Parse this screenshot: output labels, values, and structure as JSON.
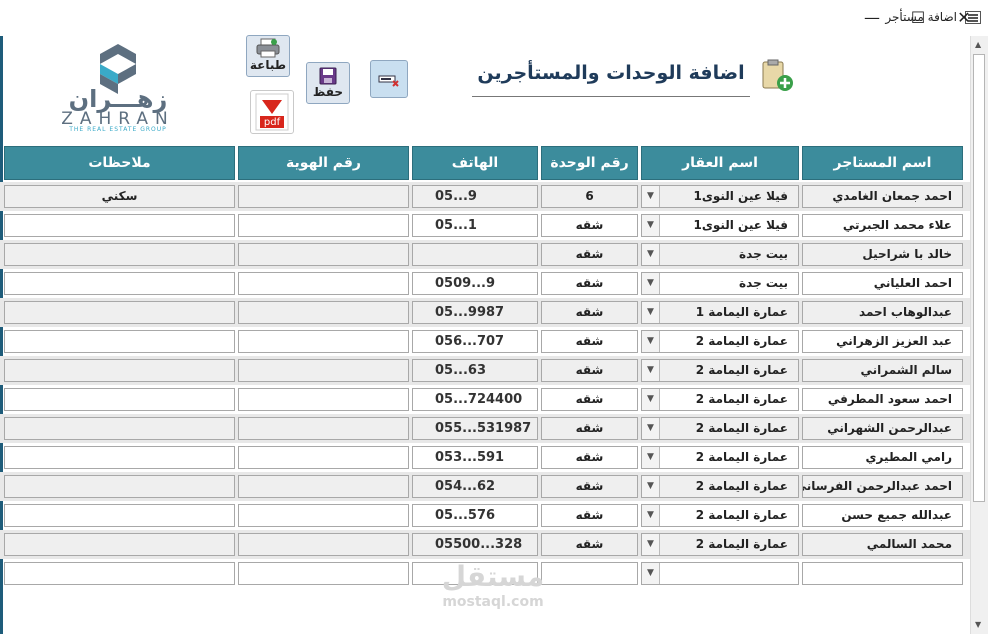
{
  "window": {
    "title": "اضافة مستأجر",
    "minimize": "—",
    "maximize": "☐",
    "close": "✕"
  },
  "logo": {
    "arabic": "زهـــران",
    "latin": "ZAHRAN",
    "tagline": "THE REAL ESTATE GROUP",
    "colors": {
      "primary": "#5d6f80",
      "accent": "#3aaac8"
    }
  },
  "toolbar": {
    "print_label": "طباعة",
    "save_label": "حفظ",
    "pdf_label": "pdf",
    "delete_icon": "delete-record-icon"
  },
  "form_title": "اضافة الوحدات والمستأجرين",
  "columns": {
    "tenant_name": "اسم المستاجر",
    "property_name": "اسم العقار",
    "unit_number": "رقم الوحدة",
    "phone": "الهاتف",
    "id_number": "رقم الهوية",
    "notes": "ملاحظات"
  },
  "rows": [
    {
      "tenant": "احمد جمعان الغامدي",
      "property": "فيلا عين النوى1",
      "unit": "6",
      "phone": "05...9",
      "id": "",
      "notes": "سكني"
    },
    {
      "tenant": "علاء محمد الجبرتي",
      "property": "فيلا عين النوى1",
      "unit": "شقه",
      "phone": "05...1",
      "id": "",
      "notes": ""
    },
    {
      "tenant": "خالد با شراحيل",
      "property": "بيت جدة",
      "unit": "شقه",
      "phone": "",
      "id": "",
      "notes": ""
    },
    {
      "tenant": "احمد العلياني",
      "property": "بيت جدة",
      "unit": "شقه",
      "phone": "0509...9",
      "id": "",
      "notes": ""
    },
    {
      "tenant": "عبدالوهاب احمد",
      "property": "عمارة اليمامة 1",
      "unit": "شقه",
      "phone": "05...9987",
      "id": "",
      "notes": ""
    },
    {
      "tenant": "عبد العزيز الزهراني",
      "property": "عمارة اليمامة 2",
      "unit": "شقه",
      "phone": "056...707",
      "id": "",
      "notes": ""
    },
    {
      "tenant": "سالم الشمراني",
      "property": "عمارة اليمامة 2",
      "unit": "شقه",
      "phone": "05...63",
      "id": "",
      "notes": ""
    },
    {
      "tenant": "احمد سعود المطرفي",
      "property": "عمارة اليمامة 2",
      "unit": "شقه",
      "phone": "05...724400",
      "id": "",
      "notes": ""
    },
    {
      "tenant": "عبدالرحمن الشهراني",
      "property": "عمارة اليمامة 2",
      "unit": "شقه",
      "phone": "055...531987",
      "id": "",
      "notes": ""
    },
    {
      "tenant": "رامي المطيري",
      "property": "عمارة اليمامة 2",
      "unit": "شقه",
      "phone": "053...591",
      "id": "",
      "notes": ""
    },
    {
      "tenant": "احمد عبدالرحمن الفرساني",
      "property": "عمارة اليمامة 2",
      "unit": "شقه",
      "phone": "054...62",
      "id": "",
      "notes": ""
    },
    {
      "tenant": "عبدالله جميع حسن",
      "property": "عمارة اليمامة 2",
      "unit": "شقه",
      "phone": "05...576",
      "id": "",
      "notes": ""
    },
    {
      "tenant": "محمد السالمي",
      "property": "عمارة اليمامة 2",
      "unit": "شقه",
      "phone": "05500...328",
      "id": "",
      "notes": ""
    },
    {
      "tenant": "",
      "property": "",
      "unit": "",
      "phone": "",
      "id": "",
      "notes": ""
    }
  ],
  "watermark": {
    "arabic": "مستقل",
    "latin": "mostaql.com"
  },
  "colors": {
    "header_bg": "#3c8c9c",
    "title_color": "#1f3b5a",
    "alt_row_bg": "#e8e8e8"
  }
}
